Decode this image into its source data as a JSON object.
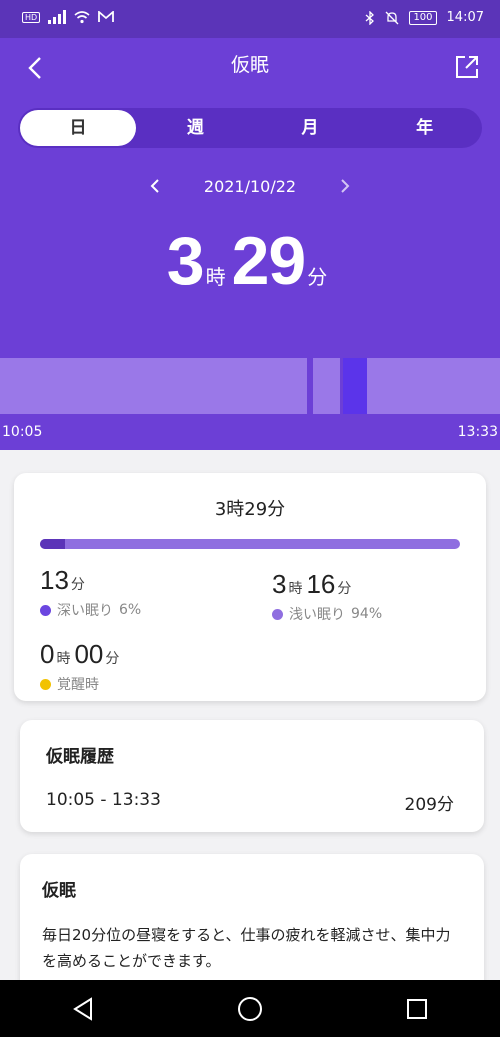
{
  "status_bar": {
    "hd": "HD",
    "battery": "100",
    "time": "14:07"
  },
  "header": {
    "title": "仮眠"
  },
  "tabs": [
    {
      "label": "日",
      "active": true
    },
    {
      "label": "週",
      "active": false
    },
    {
      "label": "月",
      "active": false
    },
    {
      "label": "年",
      "active": false
    }
  ],
  "date": "2021/10/22",
  "total": {
    "hours": "3",
    "hours_unit": "時",
    "minutes": "29",
    "minutes_unit": "分"
  },
  "timeline": {
    "start": "10:05",
    "end": "13:33"
  },
  "summary": {
    "total_text": "3時29分",
    "deep_fraction": 0.06,
    "deep": {
      "value": "13",
      "unit": "分",
      "label": "深い眠り",
      "pct": "6%"
    },
    "light": {
      "hours": "3",
      "hours_unit": "時",
      "minutes": "16",
      "minutes_unit": "分",
      "label": "浅い眠り",
      "pct": "94%"
    },
    "awake": {
      "hours": "0",
      "hours_unit": "時",
      "minutes": "00",
      "minutes_unit": "分",
      "label": "覚醒時"
    }
  },
  "history": {
    "title": "仮眠履歴",
    "range": "10:05 - 13:33",
    "minutes": "209分"
  },
  "info": {
    "title": "仮眠",
    "text": "毎日20分位の昼寝をすると、仕事の疲れを軽減させ、集中力を高めることができます。"
  },
  "colors": {
    "deep": "#6b46e0",
    "light": "#8f6ee0",
    "awake": "#f2c200",
    "primary": "#6c3fd6"
  }
}
